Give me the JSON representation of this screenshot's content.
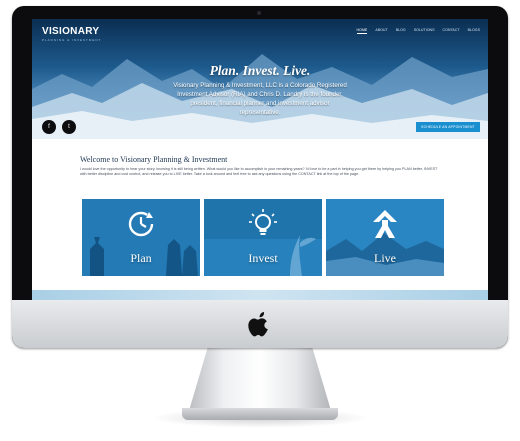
{
  "site": {
    "logo": "VISIONARY",
    "logo_sub": "PLANNING & INVESTMENT"
  },
  "nav": {
    "items": [
      "Home",
      "About",
      "Blog",
      "Solutions",
      "Contact",
      "Blogs"
    ]
  },
  "hero": {
    "tagline": "Plan. Invest. Live.",
    "intro": "Visionary Planning & Investment, LLC is a Colorado Registered Investment Advisor (RIA) and Chris D. Landry is the founder, president, financial planner and investment advisor representative.",
    "cta_label": "SCHEDULE AN APPOINTMENT",
    "social": [
      "f",
      "t"
    ]
  },
  "content": {
    "welcome_title": "Welcome to Visionary Planning & Investment",
    "welcome_text": "I would love the opportunity to hear your story, knowing it is still being written. What would you like to accomplish in your remaining years? I'd love to be a part in helping you get there by helping you PLAN better, INVEST with better discipline and cost control, and release you to LIVE better. Take a look around and feel free to ask any questions using the CONTACT link at the top of the page."
  },
  "tiles": [
    {
      "label": "Plan",
      "icon": "clock-refresh-icon"
    },
    {
      "label": "Invest",
      "icon": "lightbulb-icon"
    },
    {
      "label": "Live",
      "icon": "arrow-up-icon"
    }
  ],
  "colors": {
    "accent": "#1a8fd0",
    "tile_blue": "#1c6ea8",
    "heading": "#1b3350"
  }
}
